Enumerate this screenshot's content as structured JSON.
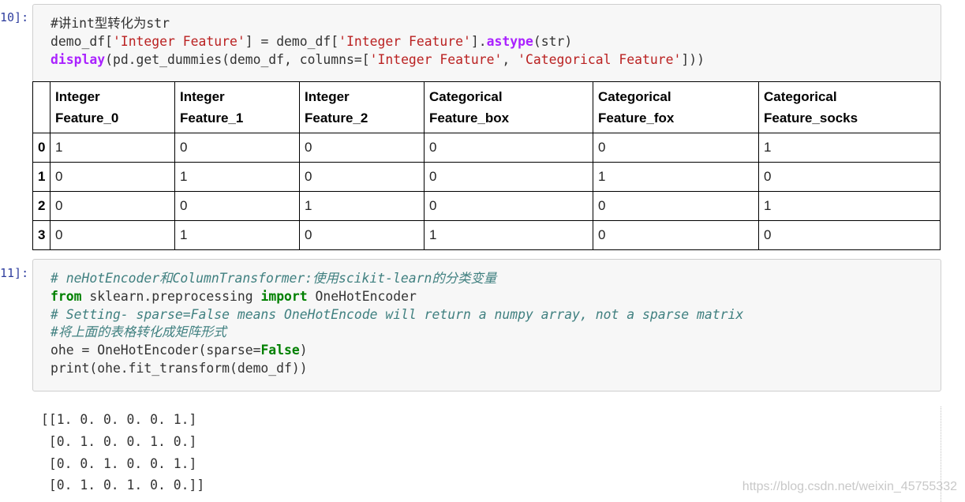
{
  "cells": [
    {
      "prompt": "10]:",
      "code_lines": [
        [
          {
            "t": "#讲int型转化为str",
            "c": "plain"
          }
        ],
        [
          {
            "t": "demo_df[",
            "c": "plain"
          },
          {
            "t": "'Integer Feature'",
            "c": "str"
          },
          {
            "t": "] = demo_df[",
            "c": "plain"
          },
          {
            "t": "'Integer Feature'",
            "c": "str"
          },
          {
            "t": "].",
            "c": "plain"
          },
          {
            "t": "astype",
            "c": "attr"
          },
          {
            "t": "(str)",
            "c": "plain"
          }
        ],
        [
          {
            "t": "display",
            "c": "fn"
          },
          {
            "t": "(pd.get_dummies(demo_df, columns=[",
            "c": "plain"
          },
          {
            "t": "'Integer Feature'",
            "c": "str"
          },
          {
            "t": ", ",
            "c": "plain"
          },
          {
            "t": "'Categorical Feature'",
            "c": "str"
          },
          {
            "t": "]))",
            "c": "plain"
          }
        ]
      ]
    },
    {
      "prompt": "11]:",
      "code_lines": [
        [
          {
            "t": "# neHotEncoder和ColumnTransformer:使用scikit-learn的分类变量",
            "c": "cm"
          }
        ],
        [
          {
            "t": "from",
            "c": "kw"
          },
          {
            "t": " sklearn.preprocessing ",
            "c": "plain"
          },
          {
            "t": "import",
            "c": "kw"
          },
          {
            "t": " OneHotEncoder",
            "c": "plain"
          }
        ],
        [
          {
            "t": "# Setting- sparse=False means OneHotEncode will return a numpy array, not a sparse matrix",
            "c": "cm"
          }
        ],
        [
          {
            "t": "#将上面的表格转化成矩阵形式",
            "c": "cm"
          }
        ],
        [
          {
            "t": "ohe = OneHotEncoder(sparse=",
            "c": "plain"
          },
          {
            "t": "False",
            "c": "cn"
          },
          {
            "t": ")",
            "c": "plain"
          }
        ],
        [
          {
            "t": "print(ohe.fit_transform(demo_df))",
            "c": "plain"
          }
        ]
      ]
    }
  ],
  "table": {
    "headers": [
      [
        "Integer",
        "Feature_0"
      ],
      [
        "Integer",
        "Feature_1"
      ],
      [
        "Integer",
        "Feature_2"
      ],
      [
        "Categorical",
        "Feature_box"
      ],
      [
        "Categorical",
        "Feature_fox"
      ],
      [
        "Categorical",
        "Feature_socks"
      ]
    ],
    "rows": [
      {
        "index": "0",
        "values": [
          "1",
          "0",
          "0",
          "0",
          "0",
          "1"
        ]
      },
      {
        "index": "1",
        "values": [
          "0",
          "1",
          "0",
          "0",
          "1",
          "0"
        ]
      },
      {
        "index": "2",
        "values": [
          "0",
          "0",
          "1",
          "0",
          "0",
          "1"
        ]
      },
      {
        "index": "3",
        "values": [
          "0",
          "1",
          "0",
          "1",
          "0",
          "0"
        ]
      }
    ]
  },
  "output_lines": [
    "[[1. 0. 0. 0. 0. 1.]",
    " [0. 1. 0. 0. 1. 0.]",
    " [0. 0. 1. 0. 0. 1.]",
    " [0. 1. 0. 1. 0. 0.]]"
  ],
  "watermark": "https://blog.csdn.net/weixin_45755332"
}
